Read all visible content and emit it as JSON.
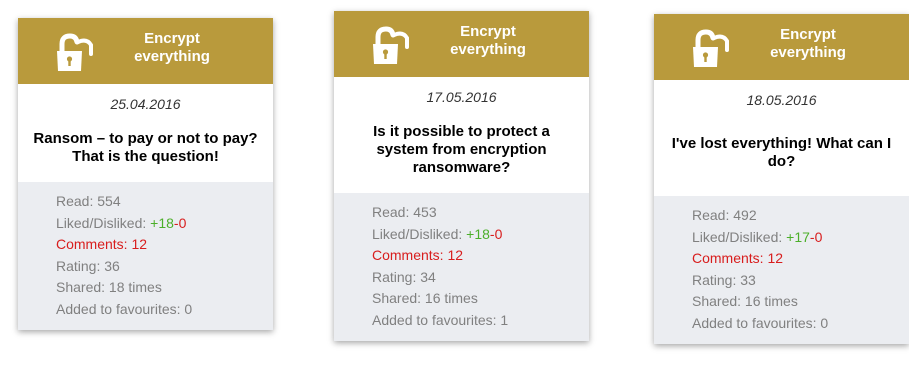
{
  "colors": {
    "header": "#b99a3c",
    "stats_bg": "#ebedf1",
    "liked": "#4caf2a",
    "disliked": "#d81d1d",
    "comments": "#d81d1d"
  },
  "icon": "padlock-icon",
  "cards": [
    {
      "brand_line1": "Encrypt",
      "brand_line2": "everything",
      "date": "25.04.2016",
      "title": "Ransom – to pay or not to pay? That is the question!",
      "read": "Read: 554",
      "liked_label": "Liked/Disliked:",
      "liked": "+18",
      "disliked": "-0",
      "comments": "Comments: 12",
      "rating": "Rating: 36",
      "shared": "Shared: 18 times",
      "favourites": "Added to favourites: 0"
    },
    {
      "brand_line1": "Encrypt",
      "brand_line2": "everything",
      "date": "17.05.2016",
      "title": "Is it possible to protect a system from encryption ransomware?",
      "read": "Read: 453",
      "liked_label": "Liked/Disliked:",
      "liked": "+18",
      "disliked": "-0",
      "comments": "Comments: 12",
      "rating": "Rating: 34",
      "shared": "Shared: 16 times",
      "favourites": "Added to favourites: 1"
    },
    {
      "brand_line1": "Encrypt",
      "brand_line2": "everything",
      "date": "18.05.2016",
      "title": "I've lost everything! What can I do?",
      "read": "Read: 492",
      "liked_label": "Liked/Disliked:",
      "liked": "+17",
      "disliked": "-0",
      "comments": "Comments: 12",
      "rating": "Rating: 33",
      "shared": "Shared: 16 times",
      "favourites": "Added to favourites: 0"
    }
  ]
}
